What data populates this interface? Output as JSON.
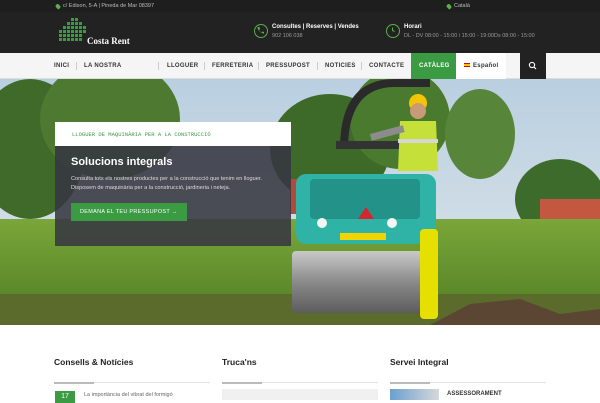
{
  "topbar": {
    "address": "c/ Edison, 5-A | Pineda de Mar 08397",
    "language": "Català"
  },
  "header": {
    "logo_text": "Costa Rent",
    "contact": {
      "title": "Consultes | Reserves | Vendes",
      "phone": "902 106 038"
    },
    "hours": {
      "title": "Horari",
      "text": "DL - DV 08:00 - 15:00 i 15:00 - 19:00Ds 08:00 - 15:00"
    }
  },
  "nav": {
    "items": [
      "INICI",
      "LA NOSTRA",
      "LLOGUER",
      "FERRETERIA",
      "PRESSUPOST",
      "NOTICIES",
      "CONTACTE"
    ],
    "catalog": "CATÀLEG",
    "language": "Español"
  },
  "hero": {
    "kicker": "LLOGUER DE MAQUINÀRIA PER A LA CONSTRUCCIÓ",
    "title": "Solucions integrals",
    "text": "Consulta tots els nostres productes per a la construcció que tenim en lloguer. Disposem de maquinària per a la construcció, jardineria i neteja.",
    "button": "DEMANA EL TEU PRESSUPOST →"
  },
  "columns": {
    "news": {
      "title": "Consells & Notícies",
      "date": "17",
      "item": "La importància del vibrat del formigó"
    },
    "tricks": {
      "title": "Truca'ns"
    },
    "service": {
      "title": "Servei Integral",
      "item": "ASSESSORAMENT"
    }
  },
  "colors": {
    "accent": "#3a9b42",
    "dark": "#222222",
    "machine": "#2fb3a7"
  }
}
